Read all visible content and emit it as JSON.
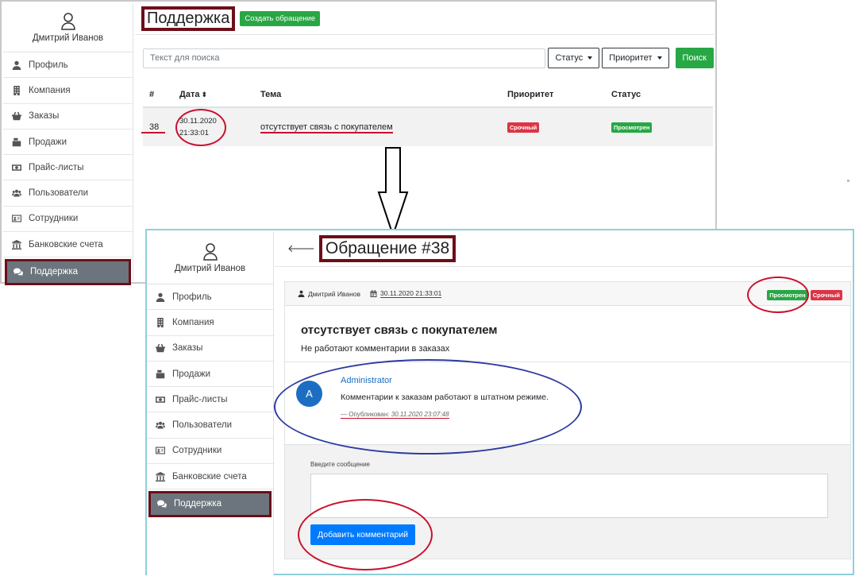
{
  "user": {
    "name": "Дмитрий Иванов"
  },
  "sidebar": {
    "items": [
      {
        "label": "Профиль",
        "icon": "user-icon"
      },
      {
        "label": "Компания",
        "icon": "building-icon"
      },
      {
        "label": "Заказы",
        "icon": "basket-icon"
      },
      {
        "label": "Продажи",
        "icon": "cash-register-icon"
      },
      {
        "label": "Прайс-листы",
        "icon": "money-bill-icon"
      },
      {
        "label": "Пользователи",
        "icon": "users-icon"
      },
      {
        "label": "Сотрудники",
        "icon": "id-card-icon"
      },
      {
        "label": "Банковские счета",
        "icon": "bank-icon"
      },
      {
        "label": "Поддержка",
        "icon": "comments-icon"
      }
    ]
  },
  "support_list": {
    "title": "Поддержка",
    "create_button": "Создать обращение",
    "search_placeholder": "Текст для поиска",
    "status_filter": "Статус",
    "priority_filter": "Приоритет",
    "search_button": "Поиск",
    "columns": {
      "num": "#",
      "date": "Дата",
      "subject": "Тема",
      "priority": "Приоритет",
      "status": "Статус"
    },
    "rows": [
      {
        "num": "38",
        "date": "30.11.2020",
        "time": "21:33:01",
        "subject": "отсутствует связь с покупателем",
        "priority": "Срочный",
        "status": "Просмотрен"
      }
    ]
  },
  "ticket": {
    "title": "Обращение #38",
    "author": "Дмитрий Иванов",
    "datetime": "30.11.2020 21:33:01",
    "status": "Просмотрен",
    "priority": "Срочный",
    "subject": "отсутствует связь с покупателем",
    "description": "Не работают комментарии в заказах",
    "comment": {
      "avatar_letter": "A",
      "author": "Administrator",
      "text": "Комментарии к заказам работают в штатном режиме.",
      "published_prefix": "— Опубликован:",
      "published_at": "30.11.2020 23:07:48"
    },
    "reply_label": "Введите сообщение",
    "add_button": "Добавить комментарий"
  },
  "colors": {
    "accent_green": "#28a745",
    "accent_red": "#dc3545",
    "primary_blue": "#007bff",
    "highlight_maroon": "#6b0f1a",
    "annotation_red": "#c8102e",
    "annotation_blue": "#2e3aa0"
  }
}
